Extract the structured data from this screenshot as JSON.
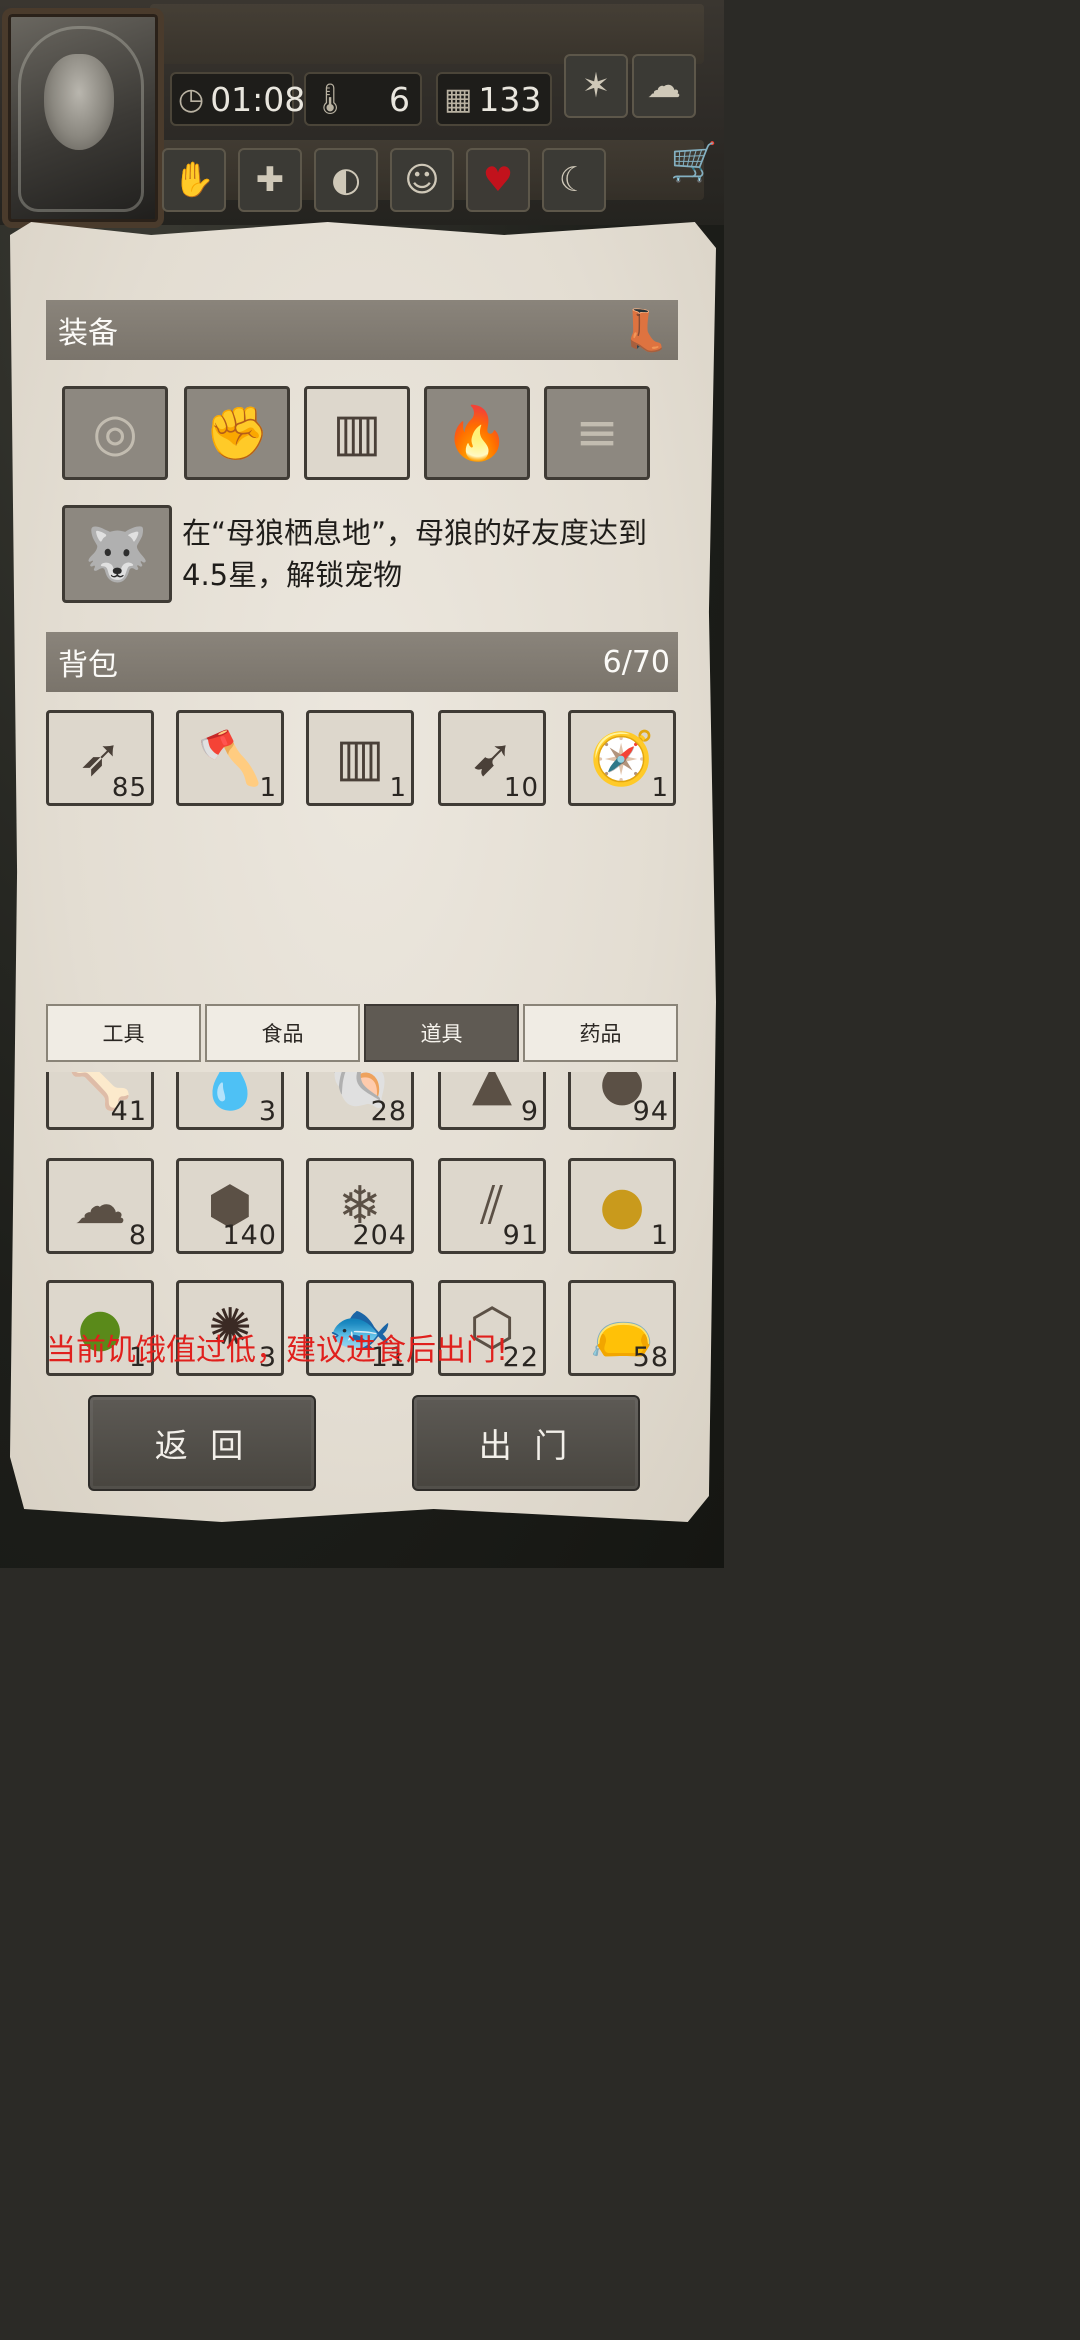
{
  "header": {
    "time": "01:08",
    "temperature": "6",
    "days": "133",
    "icons": [
      "clock-icon",
      "thermometer-icon",
      "calendar-icon",
      "leaf-icon",
      "cloud-icon"
    ],
    "status_icons": [
      "bandaged-hand-icon",
      "cross-icon",
      "stomach-icon",
      "head-icon",
      "heart-icon",
      "moon-icon"
    ],
    "cart_icon": "cart-icon"
  },
  "equipment": {
    "title": "装备",
    "slots": [
      {
        "icon": "target-icon",
        "filled": false
      },
      {
        "icon": "fist-icon",
        "filled": false
      },
      {
        "icon": "grass-skirt-icon",
        "filled": true
      },
      {
        "icon": "torch-icon",
        "filled": false
      },
      {
        "icon": "firewood-icon",
        "filled": false
      }
    ],
    "pet_hint": "在“母狼栖息地”，母狼的好友度达到4.5星，解锁宠物"
  },
  "backpack": {
    "title": "背包",
    "capacity": "6/70",
    "items": [
      {
        "icon": "arrows-icon",
        "count": "85"
      },
      {
        "icon": "axe-icon",
        "count": "1"
      },
      {
        "icon": "grass-skirt-icon",
        "count": "1"
      },
      {
        "icon": "spear-arrow-icon",
        "count": "10"
      },
      {
        "icon": "compass-icon",
        "count": "1"
      }
    ]
  },
  "tabs": [
    "工具",
    "食品",
    "道具",
    "药品"
  ],
  "active_tab": "道具",
  "storage_rows": [
    [
      {
        "icon": "bone-icon",
        "count": "41"
      },
      {
        "icon": "resin-icon",
        "count": "3"
      },
      {
        "icon": "pearl-shell-icon",
        "count": "28"
      },
      {
        "icon": "soil-icon",
        "count": "9"
      },
      {
        "icon": "stones-icon",
        "count": "94"
      }
    ],
    [
      {
        "icon": "wool-icon",
        "count": "8"
      },
      {
        "icon": "rock-icon",
        "count": "140"
      },
      {
        "icon": "salt-crystal-icon",
        "count": "204"
      },
      {
        "icon": "sticks-icon",
        "count": "91"
      },
      {
        "icon": "amber-orb-icon",
        "count": "1"
      }
    ],
    [
      {
        "icon": "green-orb-icon",
        "count": "1"
      },
      {
        "icon": "mud-icon",
        "count": "3"
      },
      {
        "icon": "fish-icon",
        "count": "11"
      },
      {
        "icon": "box-icon",
        "count": "22"
      },
      {
        "icon": "sack-icon",
        "count": "58"
      }
    ]
  ],
  "warning": "当前饥饿值过低，建议进食后出门!",
  "buttons": {
    "back": "返 回",
    "go_out": "出 门"
  }
}
